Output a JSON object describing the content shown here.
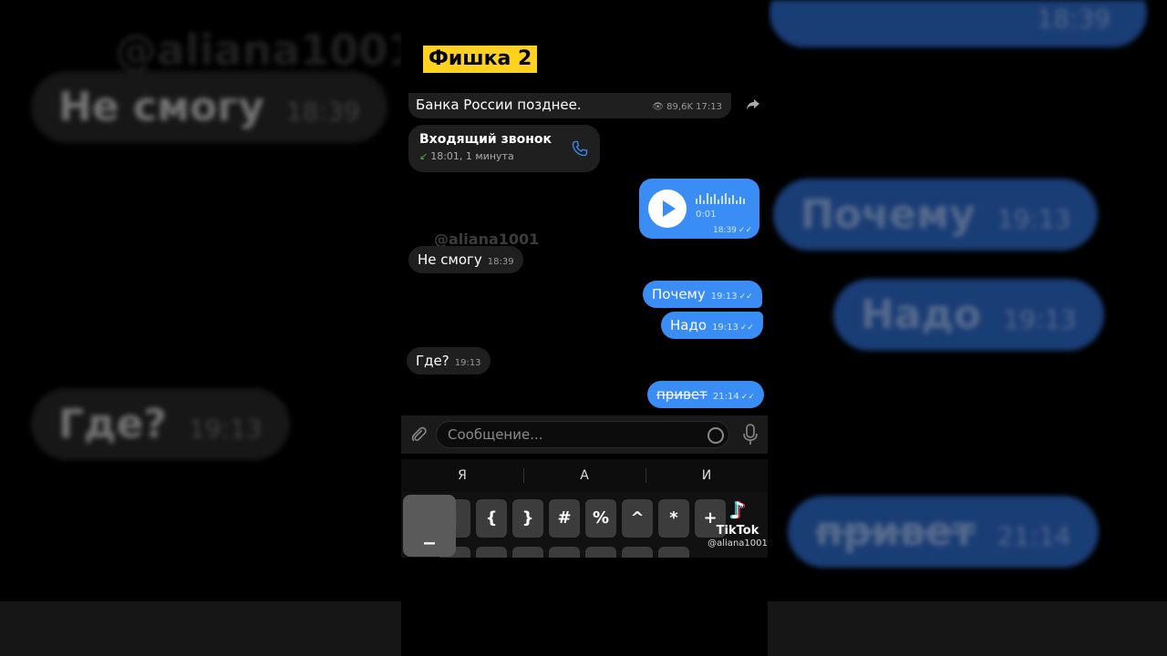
{
  "overlay": {
    "title": "Фишка 2",
    "watermark": "@aliana1001"
  },
  "channel_message": {
    "text": "Банка России позднее.",
    "meta": "89,6K 17:13"
  },
  "call": {
    "title": "Входящий звонок",
    "subtitle": "18:01, 1 минута"
  },
  "voice_message": {
    "duration": "0:01",
    "time": "18:39"
  },
  "messages": [
    {
      "text": "Не смогу",
      "time": "18:39",
      "side": "in"
    },
    {
      "text": "Почему",
      "time": "19:13",
      "side": "out"
    },
    {
      "text": "Надо",
      "time": "19:13",
      "side": "out"
    },
    {
      "text": "Где?",
      "time": "19:13",
      "side": "in"
    },
    {
      "text": "привет",
      "time": "21:14",
      "side": "out",
      "strikethrough": true
    }
  ],
  "composer": {
    "placeholder": "Сообщение..."
  },
  "keyboard": {
    "suggestions": [
      "Я",
      "А",
      "И"
    ],
    "keys": [
      "|",
      "{",
      "}",
      "#",
      "%",
      "^",
      "*",
      "+"
    ],
    "popup_key": "_"
  },
  "tiktok": {
    "brand": "TikTok",
    "handle": "@aliana1001"
  },
  "background": {
    "handle": "@aliana1001",
    "left": [
      {
        "text": "Не смогу",
        "time": "18:39"
      },
      {
        "text": "Где?",
        "time": "19:13"
      }
    ],
    "right": [
      {
        "time": "18:39"
      },
      {
        "text": "Почему",
        "time": "19:13"
      },
      {
        "text": "Надо",
        "time": "19:13"
      },
      {
        "text": "привет",
        "time": "21:14"
      }
    ]
  },
  "colors": {
    "accent": "#3a8df5",
    "incoming": "#1f1f1f",
    "highlight": "#ffd21f"
  }
}
